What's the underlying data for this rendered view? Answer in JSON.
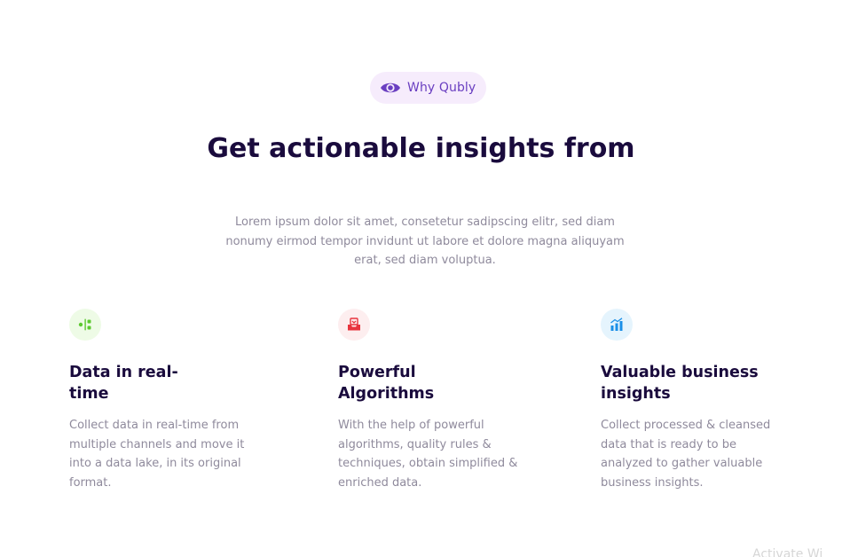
{
  "badge": {
    "icon": "eye-icon",
    "label": "Why Qubly",
    "color": "#6a3fc1",
    "background": "#f6ecfc"
  },
  "heading": {
    "title": "Get actionable insights from",
    "description": "Lorem ipsum dolor sit amet, consetetur sadipscing elitr, sed diam nonumy eirmod tempor invidunt ut labore et dolore magna aliquyam erat, sed diam voluptua."
  },
  "features": [
    {
      "icon": "data-flow-icon",
      "icon_color": "#5cc92f",
      "title": "Data in real-time",
      "description": "Collect data in real-time from multiple channels and move it into a data lake, in its original format."
    },
    {
      "icon": "inbox-tray-icon",
      "icon_color": "#e8343e",
      "title": "Powerful Algorithms",
      "description": "With the help of powerful algorithms, quality rules & techniques, obtain simplified & enriched data."
    },
    {
      "icon": "growth-chart-icon",
      "icon_color": "#1a8fe8",
      "title": "Valuable business insights",
      "description": "Collect processed & cleansed data that is ready to be analyzed to gather valuable business insights."
    }
  ],
  "watermark": {
    "text": "Activate Wi"
  }
}
